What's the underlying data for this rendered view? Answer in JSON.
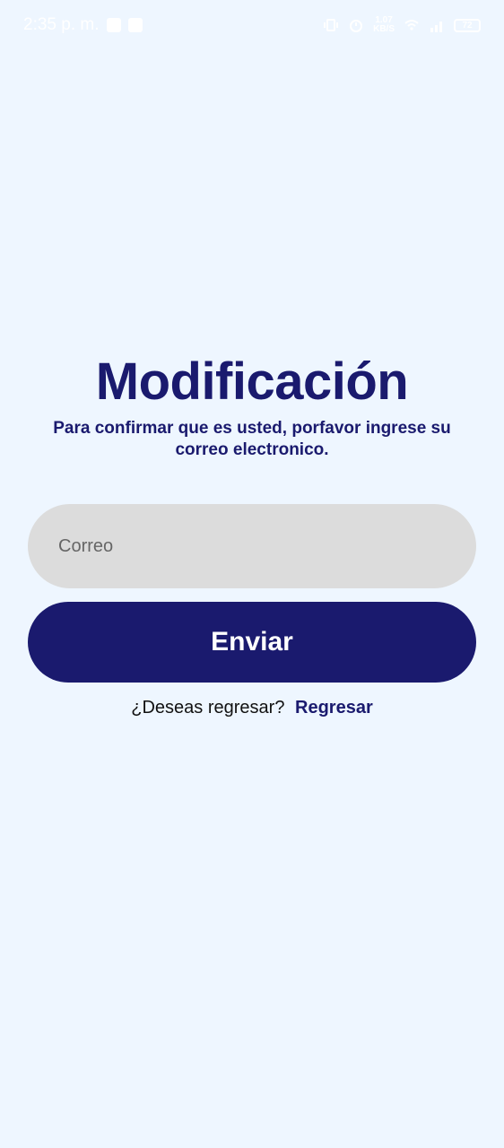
{
  "status_bar": {
    "time": "2:35 p. m.",
    "net_speed_value": "1.07",
    "net_speed_unit": "KB/S",
    "battery_level": "72"
  },
  "page": {
    "title": "Modificación",
    "subtitle": "Para confirmar que es usted, porfavor ingrese su correo electronico."
  },
  "form": {
    "email_placeholder": "Correo",
    "email_value": "",
    "submit_label": "Enviar"
  },
  "back": {
    "prompt": "¿Deseas regresar?",
    "link_label": "Regresar"
  },
  "colors": {
    "background": "#EEF6FF",
    "primary": "#1A1A6E",
    "input_bg": "#DCDCDC"
  }
}
